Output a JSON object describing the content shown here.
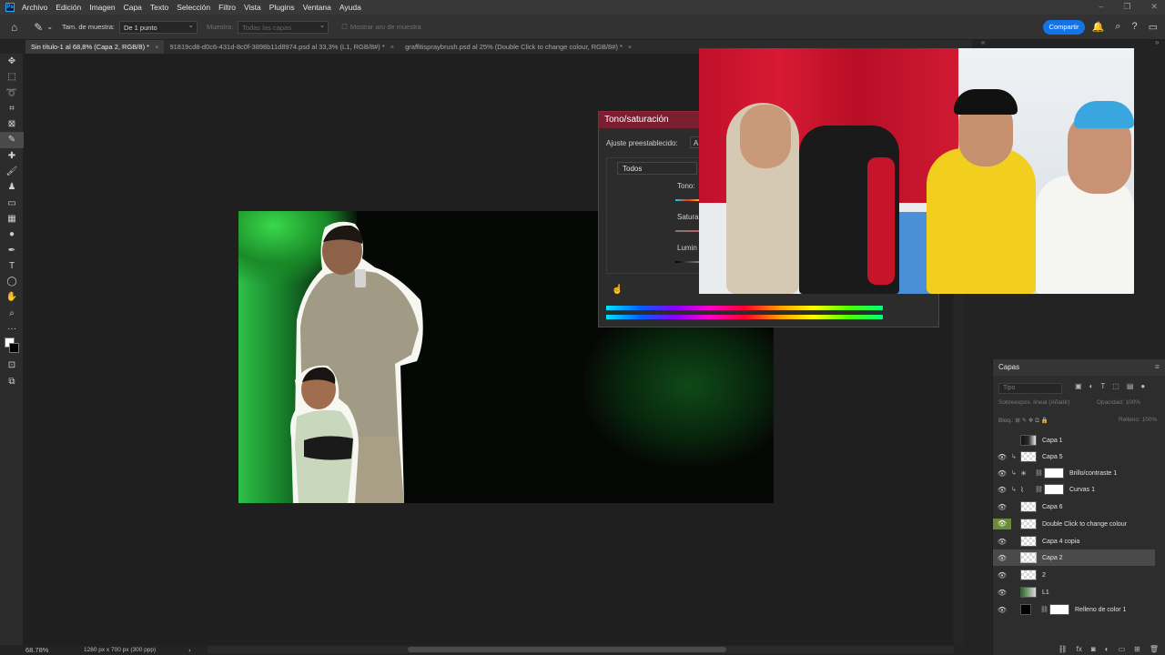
{
  "menubar": {
    "logo": "Ps",
    "items": [
      "Archivo",
      "Edición",
      "Imagen",
      "Capa",
      "Texto",
      "Selección",
      "Filtro",
      "Vista",
      "Plugins",
      "Ventana",
      "Ayuda"
    ]
  },
  "options": {
    "sample_size_label": "Tam. de muestra:",
    "sample_size_value": "De 1 punto",
    "sample_label": "Muestra:",
    "sample_value": "Todas las capas",
    "show_ring_label": "Mostrar aro de muestra",
    "share_button": "Compartir"
  },
  "tabs": [
    {
      "label": "Sin título-1 al 68,8% (Capa 2, RGB/8) *",
      "active": true
    },
    {
      "label": "91819cd8-d0c6-431d-8c0f-3898b11d8974.psd al 33,3% (L1, RGB/8#) *",
      "active": false
    },
    {
      "label": "graffitispraybrush.psd al 25% (Double Click to change colour, RGB/8#) *",
      "active": false
    }
  ],
  "status": {
    "zoom": "68.78%",
    "doc_size": "1280 px x 700 px (300 ppp)"
  },
  "dialog": {
    "title": "Tono/saturación",
    "preset_label": "Ajuste preestablecido:",
    "preset_value": "A",
    "channel_value": "Todos",
    "hue_label": "Tono:",
    "saturation_label": "Satura",
    "lightness_label": "Lumin"
  },
  "layers": {
    "title": "Capas",
    "search_placeholder": "Tipo",
    "blend_mode": "Sobreexpos. lineal (Añadir)",
    "opacity_label": "Opacidad:",
    "opacity_value": "100%",
    "lock_label": "Bloq.:",
    "fill_label": "Relleno:",
    "fill_value": "100%",
    "items": [
      {
        "name": "Capa 1",
        "visible": false,
        "thumb": "photo"
      },
      {
        "name": "Capa 5",
        "visible": true,
        "thumb": "checker"
      },
      {
        "name": "Brillo/contraste 1",
        "visible": true,
        "thumb": "white"
      },
      {
        "name": "Curvas 1",
        "visible": true,
        "thumb": "white"
      },
      {
        "name": "Capa 6",
        "visible": true,
        "thumb": "checker"
      },
      {
        "name": "Double Click to change colour",
        "visible": true,
        "thumb": "checker"
      },
      {
        "name": "Capa 4 copia",
        "visible": true,
        "thumb": "checker"
      },
      {
        "name": "Capa 2",
        "visible": true,
        "thumb": "checker"
      },
      {
        "name": "2",
        "visible": true,
        "thumb": "checker"
      },
      {
        "name": "L1",
        "visible": true,
        "thumb": "green"
      },
      {
        "name": "Relleno de color 1",
        "visible": true,
        "thumb": "black"
      }
    ]
  },
  "colors": {
    "accent": "#1473e6",
    "dialog_title": "#7a1e30",
    "canvas_green": "#2fc048"
  }
}
